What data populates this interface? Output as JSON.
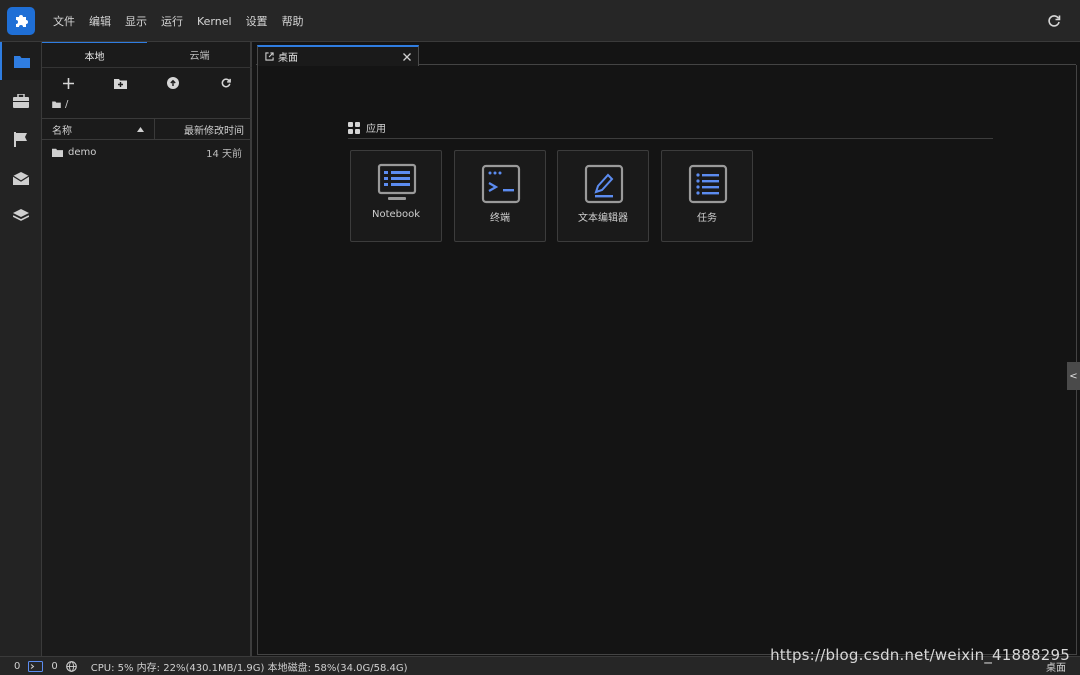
{
  "menu": {
    "items": [
      "文件",
      "编辑",
      "显示",
      "运行",
      "Kernel",
      "设置",
      "帮助"
    ]
  },
  "file_panel": {
    "tabs": [
      "本地",
      "云端"
    ],
    "breadcrumb": "/",
    "columns": {
      "name": "名称",
      "modified": "最新修改时间"
    },
    "files": [
      {
        "name": "demo",
        "modified": "14 天前"
      }
    ]
  },
  "main": {
    "tab_label": "桌面",
    "section_title": "应用",
    "cards": [
      {
        "label": "Notebook",
        "icon": "notebook-icon"
      },
      {
        "label": "终端",
        "icon": "terminal-icon"
      },
      {
        "label": "文本编辑器",
        "icon": "text-editor-icon"
      },
      {
        "label": "任务",
        "icon": "task-list-icon"
      }
    ],
    "side_toggle": "<"
  },
  "status": {
    "count_a": "0",
    "count_b": "0",
    "resources": "CPU: 5% 内存: 22%(430.1MB/1.9G) 本地磁盘: 58%(34.0G/58.4G)",
    "right_label": "桌面",
    "watermark": "https://blog.csdn.net/weixin_41888295"
  },
  "colors": {
    "accent": "#2f7de1",
    "logo_bg": "#1f6fd6",
    "icon_blue": "#5c8cf0",
    "background": "#141414"
  }
}
